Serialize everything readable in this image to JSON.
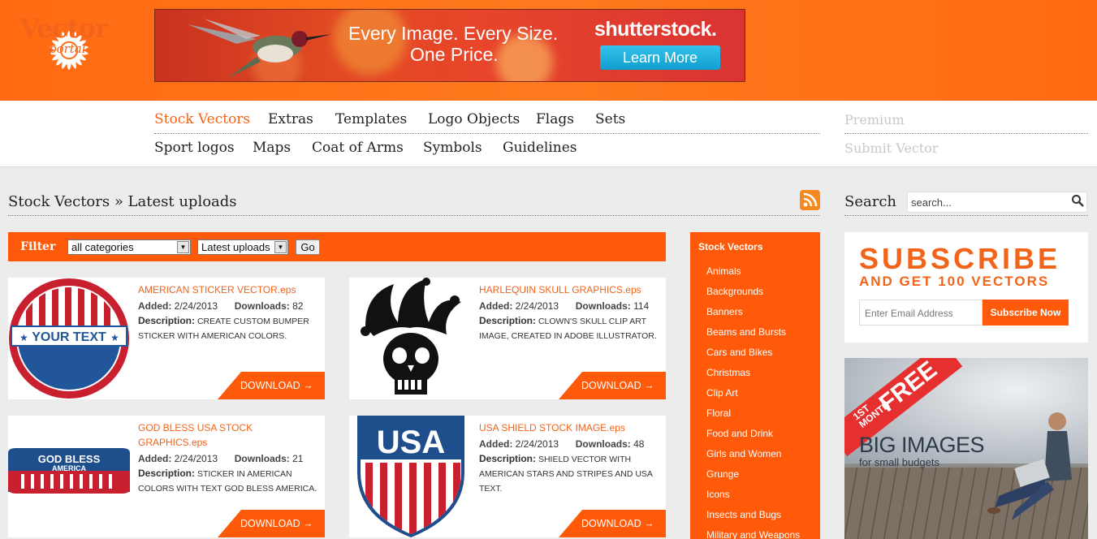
{
  "banner": {
    "tagline_1": "Every Image. Every Size.",
    "tagline_2": "One Price.",
    "brand": "shutterstock.",
    "cta": "Learn More"
  },
  "logo": {
    "word1": "Vector",
    "word2": "portal"
  },
  "nav": {
    "row1": [
      "Stock Vectors",
      "Extras",
      "Templates",
      "Logo Objects",
      "Flags",
      "Sets"
    ],
    "row2": [
      "Sport logos",
      "Maps",
      "Coat of Arms",
      "Symbols",
      "Guidelines"
    ],
    "side": [
      "Premium",
      "Submit Vector"
    ],
    "active": "Stock Vectors"
  },
  "heading": "Stock Vectors » Latest uploads",
  "search": {
    "label": "Search",
    "placeholder": "search..."
  },
  "filter": {
    "label": "Filter",
    "category_value": "all categories",
    "sort_value": "Latest uploads",
    "go_label": "Go"
  },
  "labels": {
    "added": "Added:",
    "downloads": "Downloads:",
    "description": "Description:",
    "download_button": "DOWNLOAD →"
  },
  "items": [
    {
      "title": "AMERICAN STICKER VECTOR.eps",
      "added": "2/24/2013",
      "downloads": "82",
      "description": "CREATE CUSTOM BUMPER STICKER WITH AMERICAN COLORS.",
      "thumb_text": "YOUR TEXT"
    },
    {
      "title": "HARLEQUIN SKULL GRAPHICS.eps",
      "added": "2/24/2013",
      "downloads": "114",
      "description": "CLOWN'S SKULL CLIP ART IMAGE, CREATED IN ADOBE ILLUSTRATOR."
    },
    {
      "title": "GOD BLESS USA STOCK GRAPHICS.eps",
      "added": "2/24/2013",
      "downloads": "21",
      "description": "STICKER IN AMERICAN COLORS WITH TEXT GOD BLESS AMERICA.",
      "thumb_text_1": "GOD BLESS",
      "thumb_text_2": "AMERICA"
    },
    {
      "title": "USA SHIELD STOCK IMAGE.eps",
      "added": "2/24/2013",
      "downloads": "48",
      "description": "SHIELD VECTOR WITH AMERICAN STARS AND STRIPES AND USA TEXT.",
      "thumb_text": "USA"
    }
  ],
  "categories": {
    "heading": "Stock Vectors",
    "items": [
      "Animals",
      "Backgrounds",
      "Banners",
      "Beams and Bursts",
      "Cars and Bikes",
      "Christmas",
      "Clip Art",
      "Floral",
      "Food and Drink",
      "Girls and Women",
      "Grunge",
      "Icons",
      "Insects and Bugs",
      "Military and Weapons"
    ]
  },
  "subscribe": {
    "title": "SUBSCRIBE",
    "subtitle": "AND GET 100 VECTORS",
    "email_placeholder": "Enter Email Address",
    "button": "Subscribe Now"
  },
  "promo": {
    "ribbon_small_1": "1ST",
    "ribbon_small_2": "MONTH",
    "ribbon_big": "FREE",
    "headline": "BIG IMAGES",
    "subline": "for small budgets"
  },
  "colors": {
    "accent": "#ff5a0a",
    "link": "#f26419",
    "header": "#ff6a12"
  }
}
